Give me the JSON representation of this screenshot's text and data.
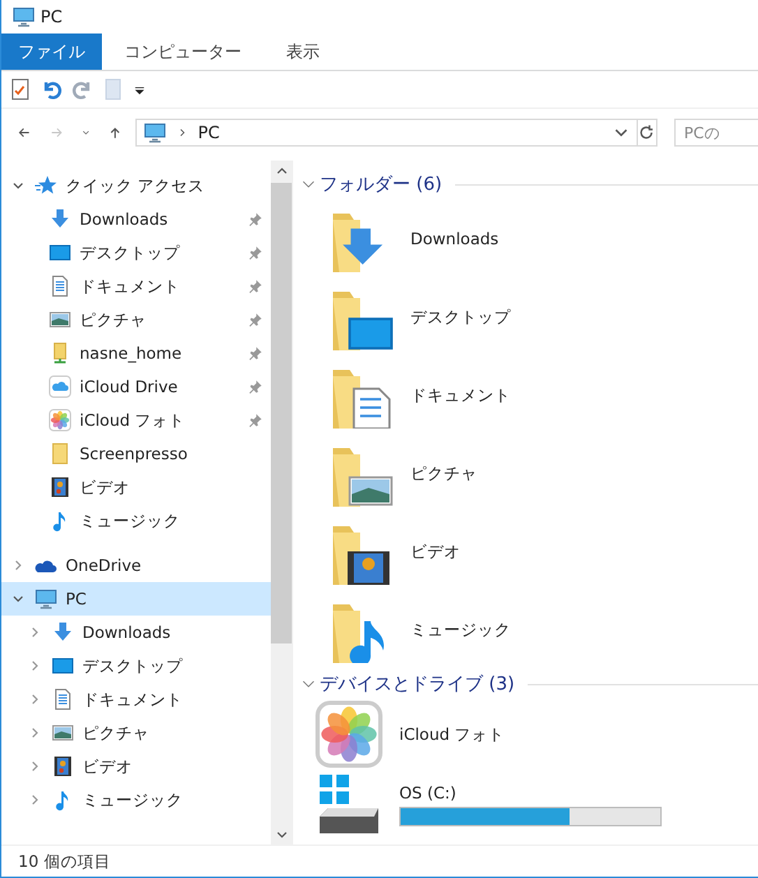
{
  "window": {
    "title": "PC"
  },
  "ribbon_tabs": [
    {
      "label": "ファイル",
      "selected": true
    },
    {
      "label": "コンピューター",
      "selected": false
    },
    {
      "label": "表示",
      "selected": false
    }
  ],
  "address": {
    "path": "PC"
  },
  "search": {
    "placeholder": "PCの"
  },
  "sidebar": {
    "items": [
      {
        "label": "クイック アクセス",
        "kind": "star",
        "expanded": true,
        "selected": false,
        "children": [
          {
            "label": "Downloads",
            "kind": "downloads",
            "pinned": true,
            "selected": false
          },
          {
            "label": "デスクトップ",
            "kind": "desktop",
            "pinned": true,
            "selected": false
          },
          {
            "label": "ドキュメント",
            "kind": "documents",
            "pinned": true,
            "selected": false
          },
          {
            "label": "ピクチャ",
            "kind": "pictures",
            "pinned": true,
            "selected": false
          },
          {
            "label": "nasne_home",
            "kind": "network",
            "pinned": true,
            "selected": false
          },
          {
            "label": "iCloud Drive",
            "kind": "icloud",
            "pinned": true,
            "selected": false
          },
          {
            "label": "iCloud フォト",
            "kind": "photos",
            "pinned": true,
            "selected": false
          },
          {
            "label": "Screenpresso",
            "kind": "folder",
            "pinned": false,
            "selected": false
          },
          {
            "label": "ビデオ",
            "kind": "video",
            "pinned": false,
            "selected": false
          },
          {
            "label": "ミュージック",
            "kind": "music",
            "pinned": false,
            "selected": false
          }
        ]
      },
      {
        "label": "OneDrive",
        "kind": "cloud",
        "expanded": false,
        "selected": false
      },
      {
        "label": "PC",
        "kind": "pc",
        "expanded": true,
        "selected": true,
        "children": [
          {
            "label": "Downloads",
            "kind": "downloads",
            "expanded": false,
            "selected": false
          },
          {
            "label": "デスクトップ",
            "kind": "desktop",
            "expanded": false,
            "selected": false
          },
          {
            "label": "ドキュメント",
            "kind": "documents",
            "expanded": false,
            "selected": false
          },
          {
            "label": "ピクチャ",
            "kind": "pictures",
            "expanded": false,
            "selected": false
          },
          {
            "label": "ビデオ",
            "kind": "video",
            "expanded": false,
            "selected": false
          },
          {
            "label": "ミュージック",
            "kind": "music",
            "expanded": false,
            "selected": false
          }
        ]
      }
    ]
  },
  "groups": [
    {
      "title": "フォルダー (6)",
      "expanded": true,
      "items": [
        {
          "name": "Downloads",
          "kind": "downloads"
        },
        {
          "name": "デスクトップ",
          "kind": "desktop"
        },
        {
          "name": "ドキュメント",
          "kind": "documents"
        },
        {
          "name": "ピクチャ",
          "kind": "pictures"
        },
        {
          "name": "ビデオ",
          "kind": "video"
        },
        {
          "name": "ミュージック",
          "kind": "music"
        }
      ]
    },
    {
      "title": "デバイスとドライブ (3)",
      "expanded": true,
      "items": [
        {
          "name": "iCloud フォト",
          "kind": "photos"
        },
        {
          "name": "OS (C:)",
          "kind": "drive",
          "level": 0.65
        }
      ]
    }
  ],
  "status_bar": {
    "text": "10 個の項目"
  }
}
